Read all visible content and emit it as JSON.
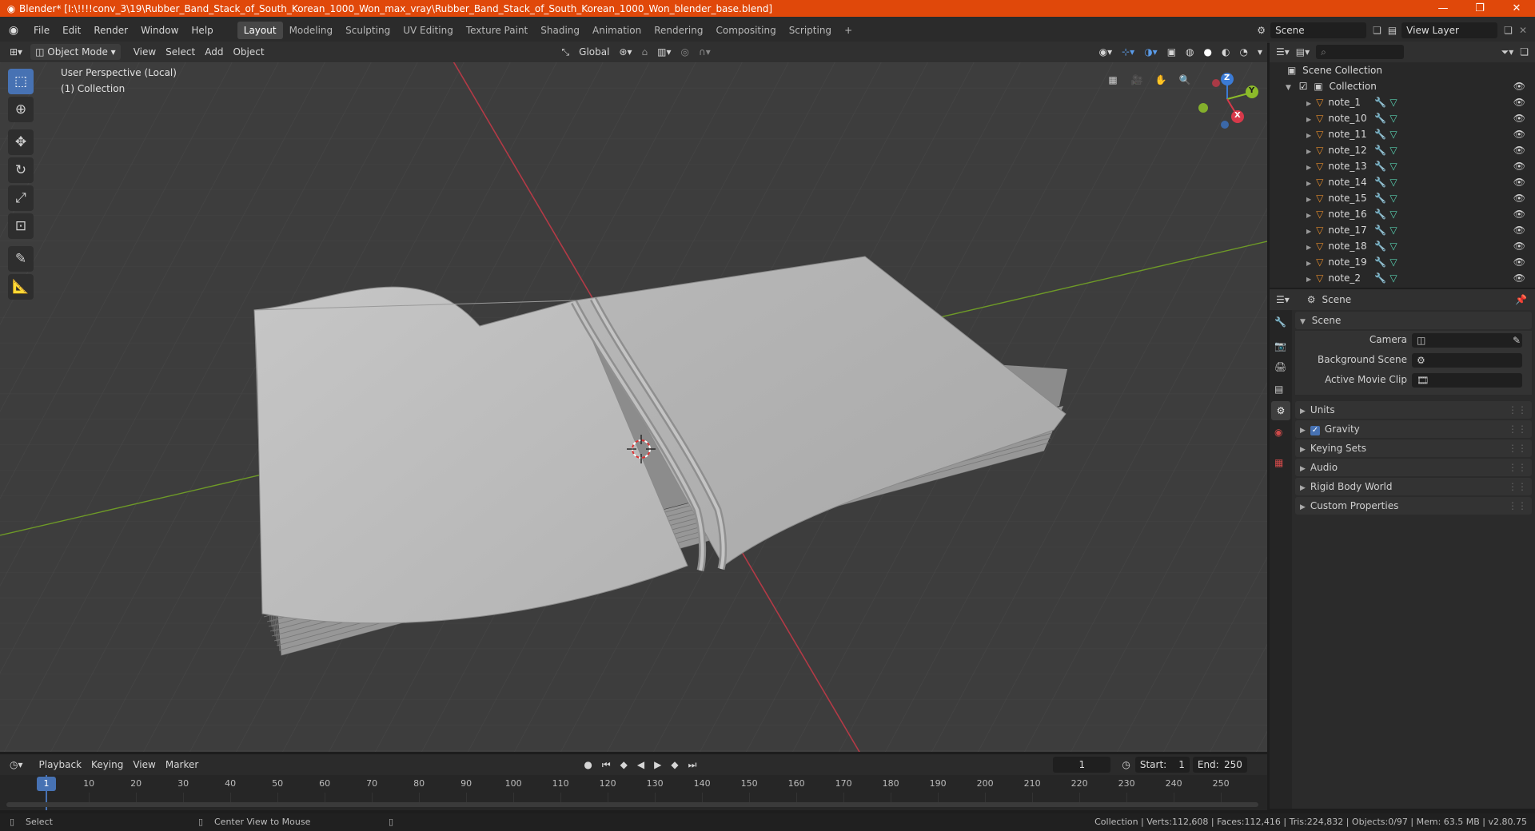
{
  "window": {
    "title": "Blender* [I:\\!!!!conv_3\\19\\Rubber_Band_Stack_of_South_Korean_1000_Won_max_vray\\Rubber_Band_Stack_of_South_Korean_1000_Won_blender_base.blend]",
    "minimize": "—",
    "maximize": "❐",
    "close": "✕"
  },
  "menu": [
    "File",
    "Edit",
    "Render",
    "Window",
    "Help"
  ],
  "workspaces": [
    "Layout",
    "Modeling",
    "Sculpting",
    "UV Editing",
    "Texture Paint",
    "Shading",
    "Animation",
    "Rendering",
    "Compositing",
    "Scripting"
  ],
  "add_workspace": "+",
  "scene_field": "Scene",
  "view_layer_field": "View Layer",
  "viewport_header": {
    "mode": "Object Mode",
    "menus": [
      "View",
      "Select",
      "Add",
      "Object"
    ],
    "transform_orientation": "Global"
  },
  "viewport": {
    "perspective_label": "User Perspective (Local)",
    "collection_label": "(1) Collection",
    "gizmo_axes": {
      "x": "X",
      "y": "Y",
      "z": "Z"
    }
  },
  "outliner": {
    "root": "Scene Collection",
    "collection": "Collection",
    "objects": [
      "note_1",
      "note_10",
      "note_11",
      "note_12",
      "note_13",
      "note_14",
      "note_15",
      "note_16",
      "note_17",
      "note_18",
      "note_19",
      "note_2"
    ]
  },
  "properties": {
    "header": "Scene",
    "section": "Scene",
    "fields": [
      {
        "label": "Camera",
        "value": ""
      },
      {
        "label": "Background Scene",
        "value": ""
      },
      {
        "label": "Active Movie Clip",
        "value": ""
      }
    ],
    "panels": [
      "Units",
      "Gravity",
      "Keying Sets",
      "Audio",
      "Rigid Body World",
      "Custom Properties"
    ]
  },
  "timeline": {
    "menus": [
      "Playback",
      "Keying",
      "View",
      "Marker"
    ],
    "current_frame": "1",
    "start_label": "Start:",
    "start": "1",
    "end_label": "End:",
    "end": "250",
    "ruler": [
      "1",
      "10",
      "20",
      "30",
      "40",
      "50",
      "60",
      "70",
      "80",
      "90",
      "100",
      "110",
      "120",
      "130",
      "140",
      "150",
      "160",
      "170",
      "180",
      "190",
      "200",
      "210",
      "220",
      "230",
      "240",
      "250"
    ]
  },
  "statusbar": {
    "select": "Select",
    "center_view": "Center View to Mouse",
    "stats": "Collection | Verts:112,608 | Faces:112,416 | Tris:224,832 | Objects:0/97 | Mem: 63.5 MB | v2.80.75"
  },
  "colors": {
    "titlebar": "#e0480a",
    "accent": "#4772b3",
    "axis_x": "#d7394a",
    "axis_y": "#8cbb2a",
    "axis_z": "#3b7bd6",
    "mesh_icon": "#e48b2b",
    "modifier_icon": "#5a9be8",
    "data_icon": "#58d0b0"
  }
}
